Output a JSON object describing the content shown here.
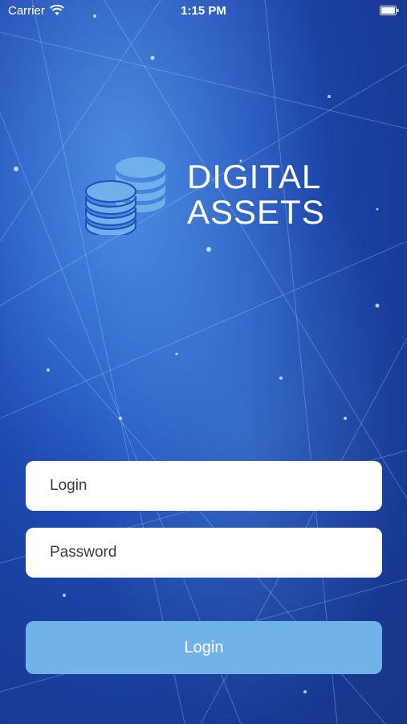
{
  "status_bar": {
    "carrier": "Carrier",
    "time": "1:15 PM"
  },
  "logo": {
    "line1": "DIGITAL",
    "line2": "ASSETS",
    "icon": "coins-stack-icon",
    "icon_color": "#6fb0ea"
  },
  "form": {
    "login_placeholder": "Login",
    "password_placeholder": "Password",
    "submit_label": "Login"
  },
  "colors": {
    "background": "#1f4fb8",
    "button": "#71b2e9",
    "field": "#ffffff"
  }
}
